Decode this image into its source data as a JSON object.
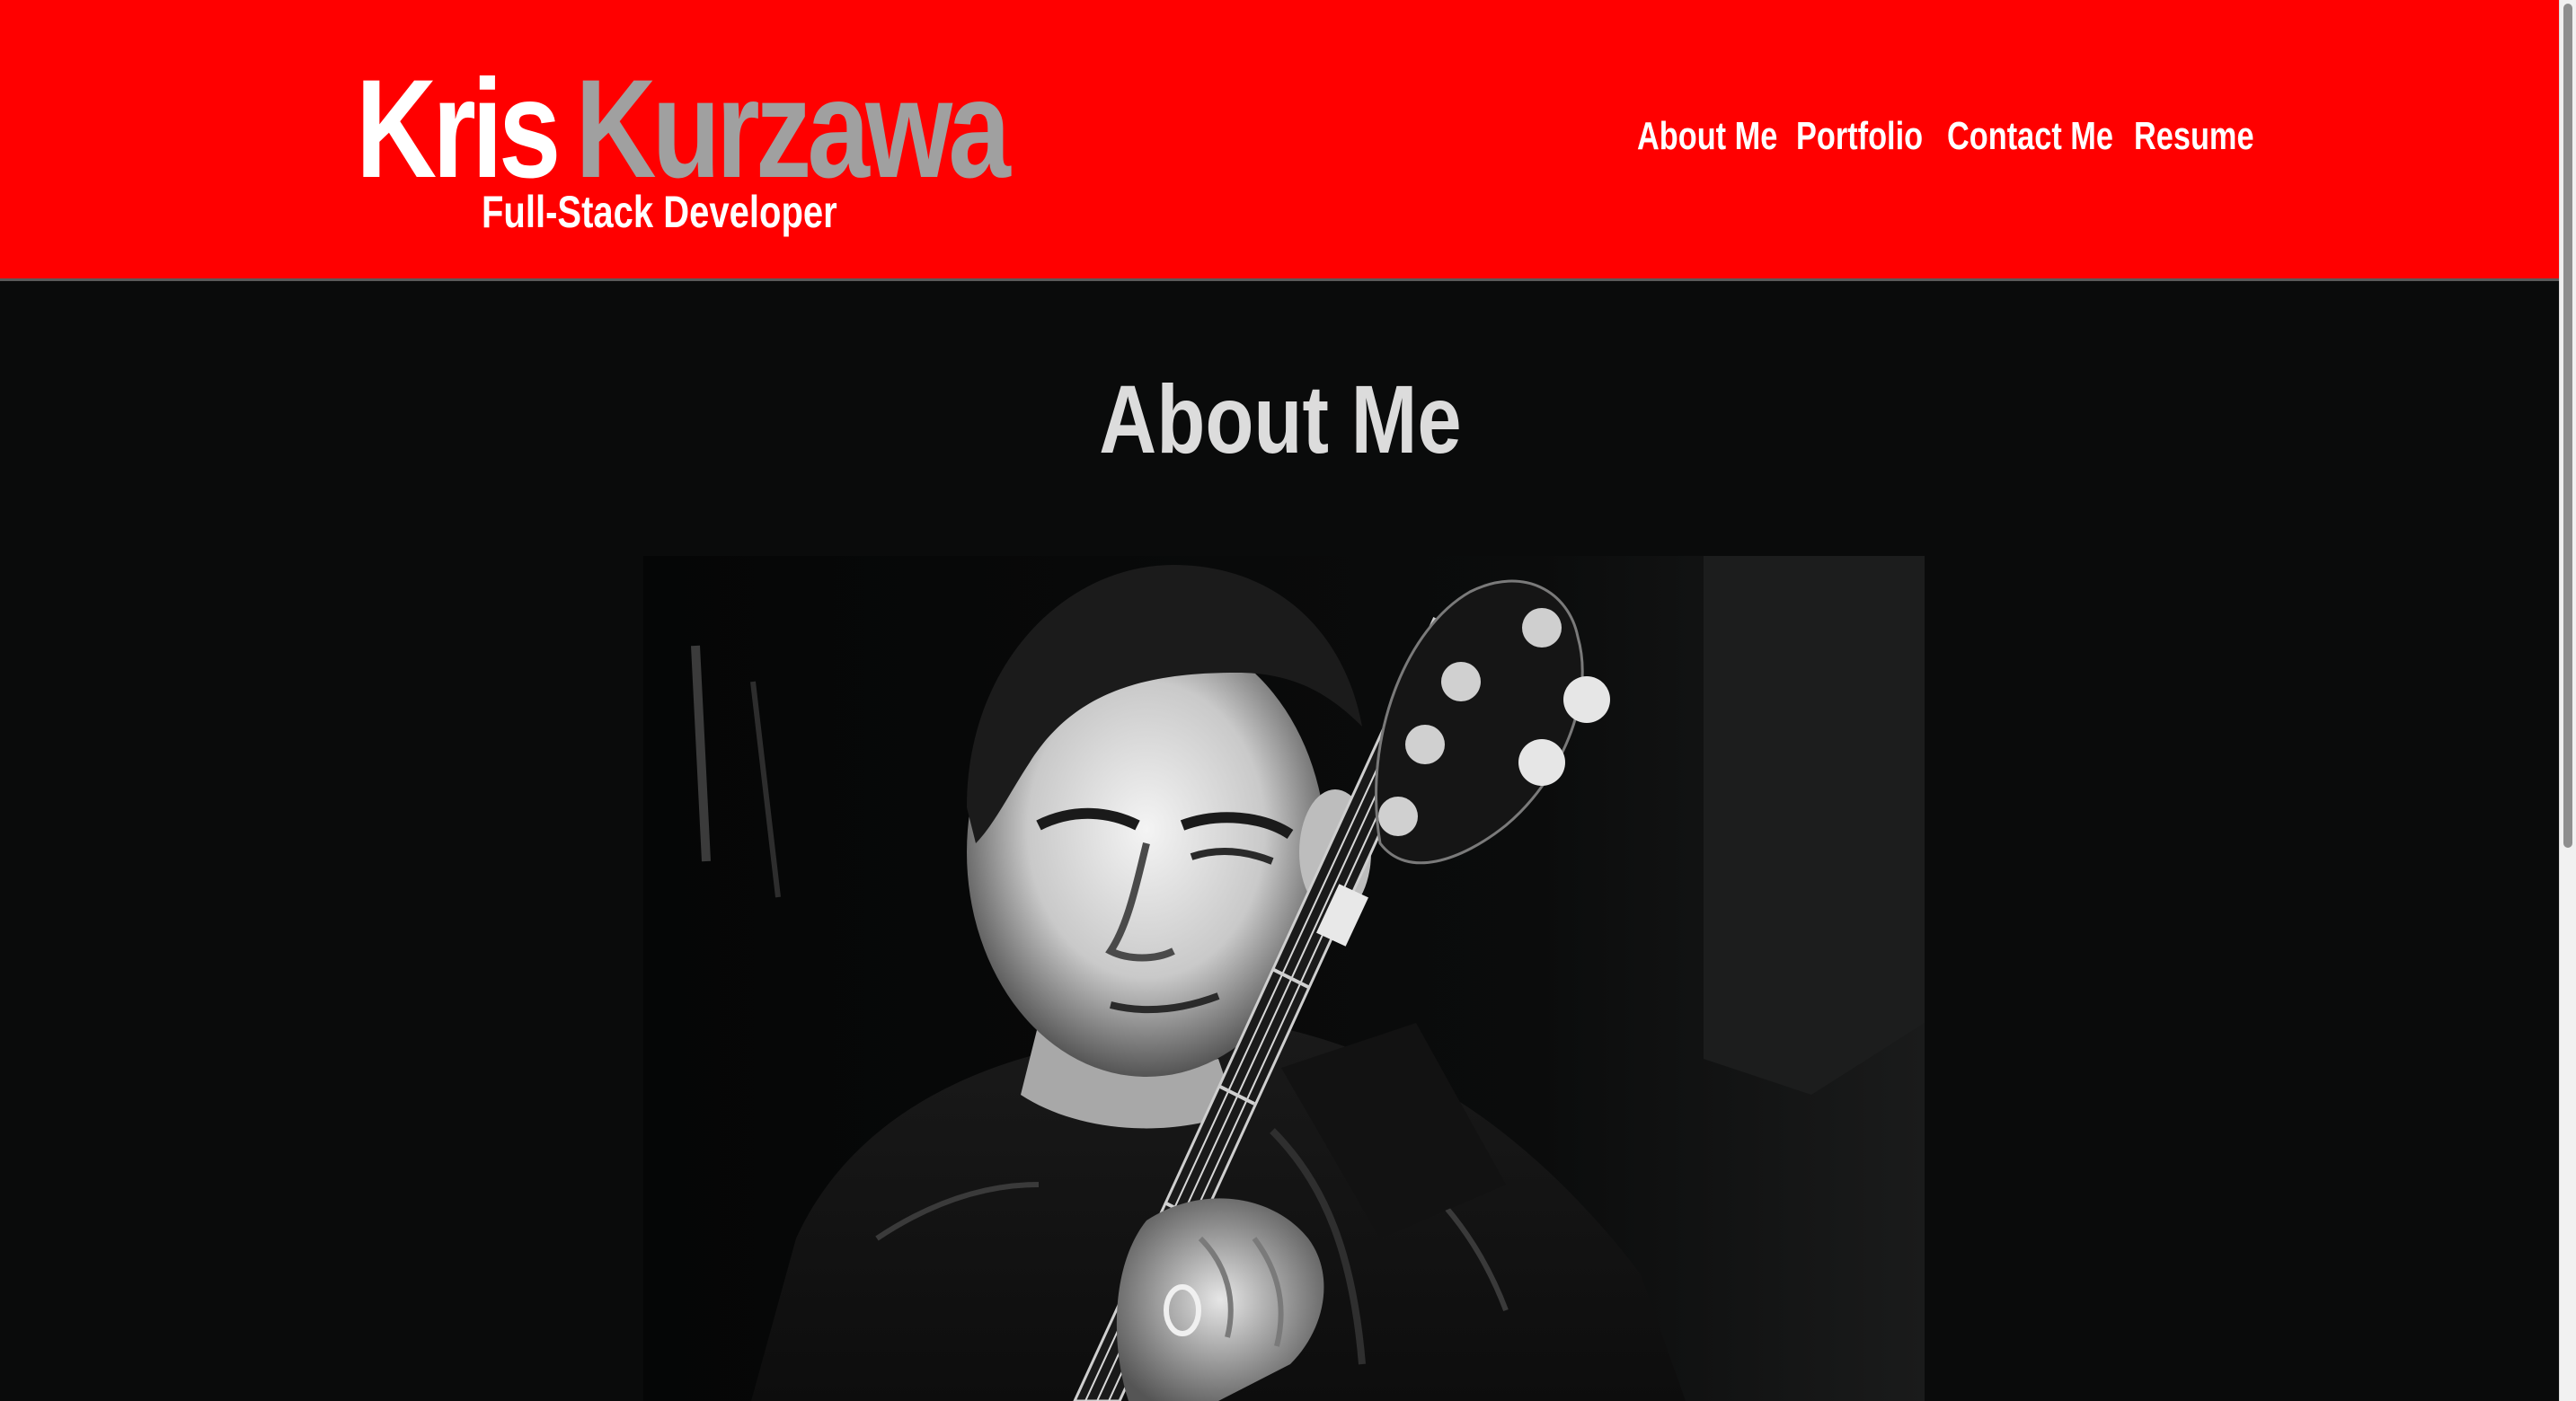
{
  "header": {
    "first_name": "Kris",
    "last_name": "Kurzawa",
    "tagline": "Full-Stack Developer",
    "nav": [
      {
        "label": "About Me"
      },
      {
        "label": "Portfolio"
      },
      {
        "label": "Contact Me"
      },
      {
        "label": "Resume"
      }
    ]
  },
  "main": {
    "section_title": "About Me",
    "photo_description_icon": "profile-photo"
  },
  "colors": {
    "header_bg": "#ff0000",
    "page_bg": "#0a0b0b",
    "last_name": "#a0a0a0",
    "title": "#dcdcdc"
  }
}
